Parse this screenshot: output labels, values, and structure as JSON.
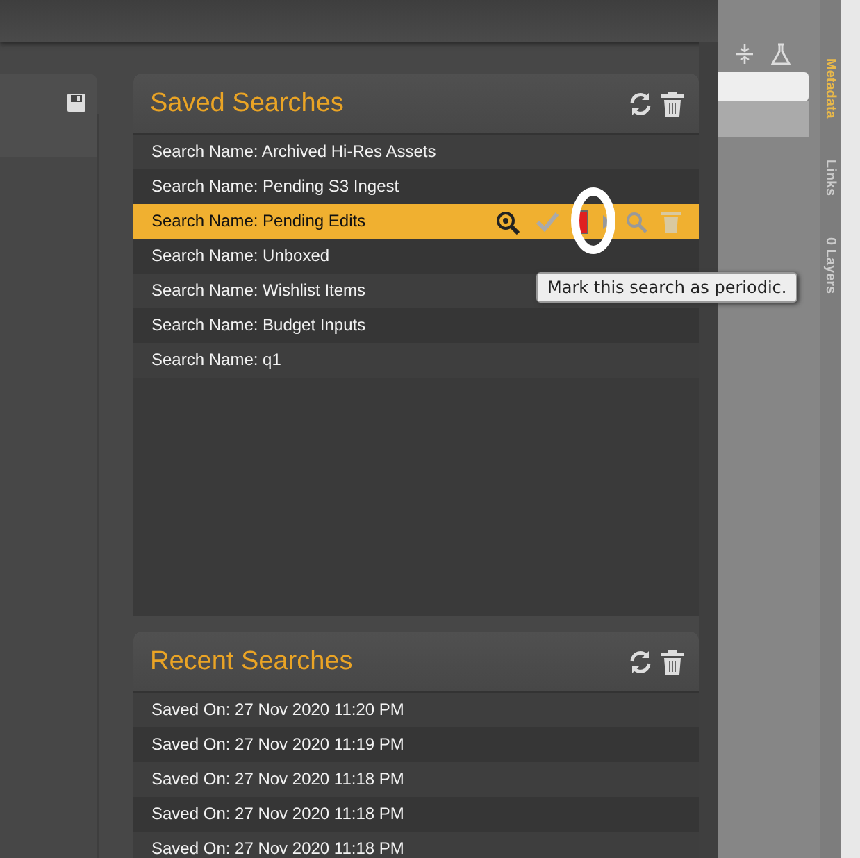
{
  "saved_searches": {
    "title": "Saved Searches",
    "items": [
      {
        "label": "Search Name: Archived Hi-Res Assets",
        "selected": false
      },
      {
        "label": "Search Name: Pending S3 Ingest",
        "selected": false
      },
      {
        "label": "Search Name: Pending Edits",
        "selected": true
      },
      {
        "label": "Search Name: Unboxed",
        "selected": false
      },
      {
        "label": "Search Name: Wishlist Items",
        "selected": false
      },
      {
        "label": "Search Name: Budget Inputs",
        "selected": false
      },
      {
        "label": "Search Name: q1",
        "selected": false
      }
    ]
  },
  "tooltip": "Mark this search as periodic.",
  "recent_searches": {
    "title": "Recent Searches",
    "items": [
      {
        "label": "Saved On: 27 Nov 2020 11:20 PM"
      },
      {
        "label": "Saved On: 27 Nov 2020 11:19 PM"
      },
      {
        "label": "Saved On: 27 Nov 2020 11:18 PM"
      },
      {
        "label": "Saved On: 27 Nov 2020 11:18 PM"
      },
      {
        "label": "Saved On: 27 Nov 2020 11:18 PM"
      }
    ]
  },
  "side_tabs": [
    {
      "label": "Metadata",
      "selected": true
    },
    {
      "label": "Links",
      "selected": false
    },
    {
      "label": "0 Layers",
      "selected": false
    }
  ]
}
